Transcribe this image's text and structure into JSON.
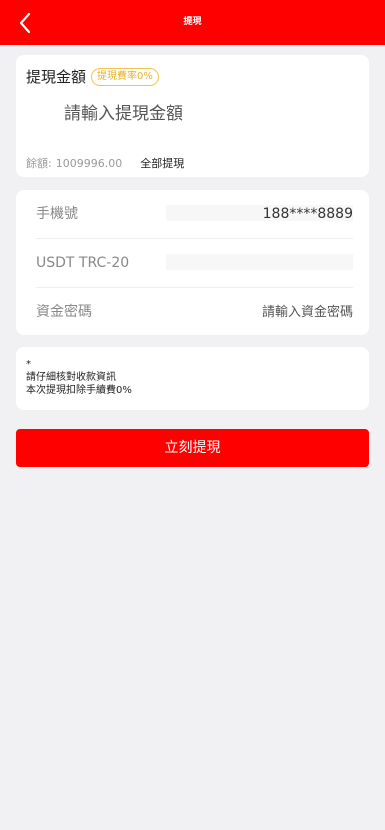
{
  "header": {
    "title": "提現",
    "back_icon": "chevron-left-icon",
    "background": "#ff0000"
  },
  "amount_card": {
    "title": "提現金額",
    "fee_badge": "提現費率0%",
    "amount_placeholder": "請輸入提現金額",
    "balance_label": "餘額:",
    "balance_value": "1009996.00",
    "withdraw_all": "全部提現"
  },
  "info_card": {
    "phone_label": "手機號",
    "phone_value": "188****8889",
    "usdt_label": "USDT TRC-20",
    "usdt_value": "",
    "password_label": "資金密碼",
    "password_placeholder": "請輸入資金密碼"
  },
  "notice": {
    "star": "*",
    "line1": "請仔細核對收款資訊",
    "line2": "本次提現扣除手續費0%"
  },
  "submit_label": "立刻提現",
  "colors": {
    "accent": "#ff0000",
    "badge": "#e8b12a",
    "background": "#f1f1f3"
  }
}
